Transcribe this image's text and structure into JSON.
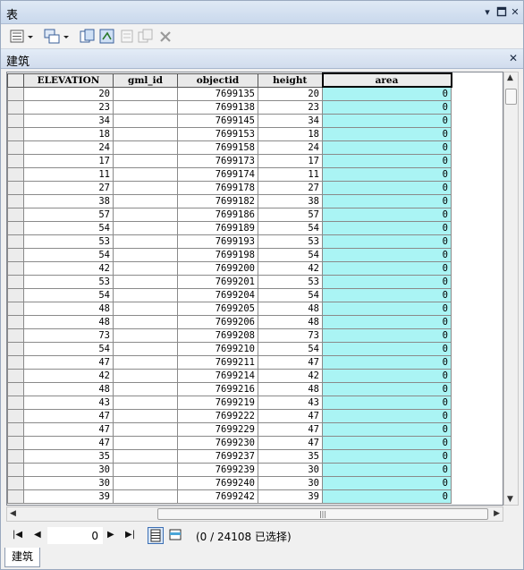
{
  "window": {
    "title": "表"
  },
  "titlebar_controls": [
    "pin-icon",
    "restore-icon",
    "close-icon"
  ],
  "toolbar": {
    "icons": [
      "table-options-icon",
      "related-tables-icon",
      "select-by-attributes-icon",
      "switch-selection-icon",
      "clear-selection-icon",
      "zoom-to-selected-icon",
      "delete-selected-icon"
    ]
  },
  "tab": {
    "name": "建筑"
  },
  "table": {
    "columns": [
      "ELEVATION",
      "gml_id",
      "objectid",
      "height",
      "area"
    ],
    "rows": [
      [
        "20",
        "",
        "7699135",
        "20",
        "0"
      ],
      [
        "23",
        "",
        "7699138",
        "23",
        "0"
      ],
      [
        "34",
        "",
        "7699145",
        "34",
        "0"
      ],
      [
        "18",
        "",
        "7699153",
        "18",
        "0"
      ],
      [
        "24",
        "",
        "7699158",
        "24",
        "0"
      ],
      [
        "17",
        "",
        "7699173",
        "17",
        "0"
      ],
      [
        "11",
        "",
        "7699174",
        "11",
        "0"
      ],
      [
        "27",
        "",
        "7699178",
        "27",
        "0"
      ],
      [
        "38",
        "",
        "7699182",
        "38",
        "0"
      ],
      [
        "57",
        "",
        "7699186",
        "57",
        "0"
      ],
      [
        "54",
        "",
        "7699189",
        "54",
        "0"
      ],
      [
        "53",
        "",
        "7699193",
        "53",
        "0"
      ],
      [
        "54",
        "",
        "7699198",
        "54",
        "0"
      ],
      [
        "42",
        "",
        "7699200",
        "42",
        "0"
      ],
      [
        "53",
        "",
        "7699201",
        "53",
        "0"
      ],
      [
        "54",
        "",
        "7699204",
        "54",
        "0"
      ],
      [
        "48",
        "",
        "7699205",
        "48",
        "0"
      ],
      [
        "48",
        "",
        "7699206",
        "48",
        "0"
      ],
      [
        "73",
        "",
        "7699208",
        "73",
        "0"
      ],
      [
        "54",
        "",
        "7699210",
        "54",
        "0"
      ],
      [
        "47",
        "",
        "7699211",
        "47",
        "0"
      ],
      [
        "42",
        "",
        "7699214",
        "42",
        "0"
      ],
      [
        "48",
        "",
        "7699216",
        "48",
        "0"
      ],
      [
        "43",
        "",
        "7699219",
        "43",
        "0"
      ],
      [
        "47",
        "",
        "7699222",
        "47",
        "0"
      ],
      [
        "47",
        "",
        "7699229",
        "47",
        "0"
      ],
      [
        "47",
        "",
        "7699230",
        "47",
        "0"
      ],
      [
        "35",
        "",
        "7699237",
        "35",
        "0"
      ],
      [
        "30",
        "",
        "7699239",
        "30",
        "0"
      ],
      [
        "30",
        "",
        "7699240",
        "30",
        "0"
      ],
      [
        "39",
        "",
        "7699242",
        "39",
        "0"
      ]
    ]
  },
  "navigation": {
    "current_record": "0",
    "status": "(0 / 24108 已选择)"
  },
  "bottom_tab": {
    "label": "建筑"
  },
  "colors": {
    "selected_column": "#aaf4f4",
    "titlebar": "#c9d8ec"
  }
}
